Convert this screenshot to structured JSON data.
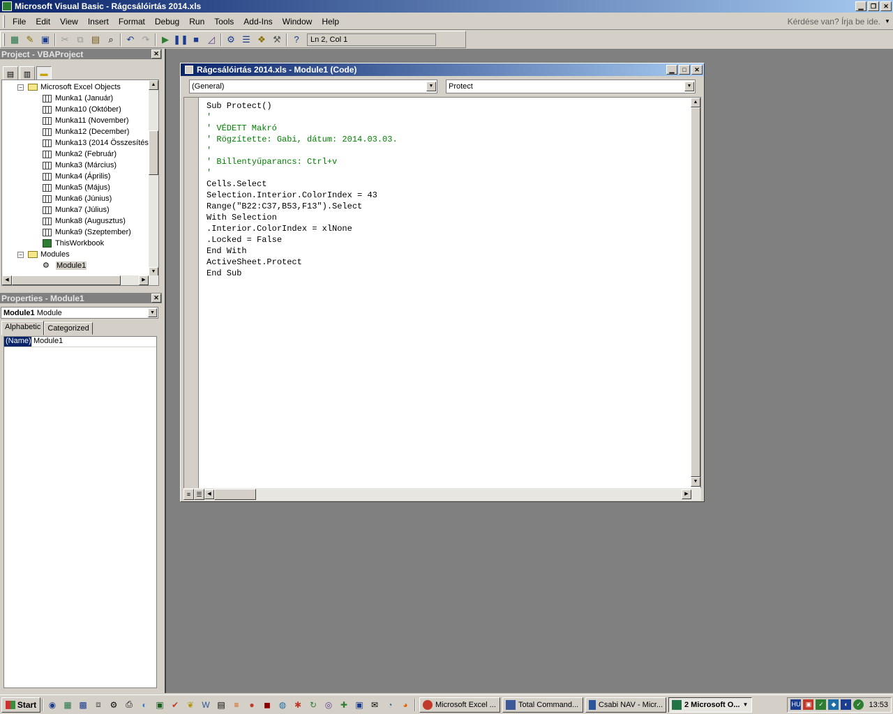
{
  "window": {
    "title": "Microsoft Visual Basic - Rágcsálóirtás 2014.xls",
    "minimize_glyph": "▁",
    "restore_glyph": "❐",
    "close_glyph": "✕"
  },
  "menu": {
    "items": [
      "File",
      "Edit",
      "View",
      "Insert",
      "Format",
      "Debug",
      "Run",
      "Tools",
      "Add-Ins",
      "Window",
      "Help"
    ],
    "help_box": "Kérdése van? Írja be ide."
  },
  "toolbar": {
    "position": "Ln 2, Col 1",
    "icons": [
      "excel-icon",
      "insert-module-icon",
      "save-icon",
      "cut-icon",
      "copy-icon",
      "paste-icon",
      "find-icon",
      "undo-icon",
      "redo-icon",
      "run-icon",
      "break-icon",
      "reset-icon",
      "design-mode-icon",
      "project-explorer-icon",
      "properties-icon",
      "object-browser-icon",
      "toolbox-icon",
      "help-icon"
    ]
  },
  "project_pane": {
    "title": "Project - VBAProject",
    "folder_excel_objects": "Microsoft Excel Objects",
    "sheets": [
      "Munka1 (Január)",
      "Munka10 (Október)",
      "Munka11 (November)",
      "Munka12 (December)",
      "Munka13 (2014 Összesítés)",
      "Munka2 (Február)",
      "Munka3 (Március)",
      "Munka4 (Április)",
      "Munka5 (Május)",
      "Munka6 (Június)",
      "Munka7 (Július)",
      "Munka8 (Augusztus)",
      "Munka9 (Szeptember)"
    ],
    "workbook": "ThisWorkbook",
    "folder_modules": "Modules",
    "module": "Module1"
  },
  "properties_pane": {
    "title": "Properties - Module1",
    "object_name": "Module1",
    "object_type": "Module",
    "tab_alphabetic": "Alphabetic",
    "tab_categorized": "Categorized",
    "prop_name": "(Name)",
    "prop_value": "Module1"
  },
  "code_window": {
    "title": "Rágcsálóirtás 2014.xls - Module1 (Code)",
    "object_combo": "(General)",
    "proc_combo": "Protect",
    "lines": [
      {
        "text": "Sub Protect()",
        "kind": "code"
      },
      {
        "text": "'",
        "kind": "comment"
      },
      {
        "text": "' VÉDETT Makró",
        "kind": "comment"
      },
      {
        "text": "' Rögzítette: Gabi, dátum: 2014.03.03.",
        "kind": "comment"
      },
      {
        "text": "'",
        "kind": "comment"
      },
      {
        "text": "' Billentyűparancs: Ctrl+v",
        "kind": "comment"
      },
      {
        "text": "'",
        "kind": "comment"
      },
      {
        "text": "Cells.Select",
        "kind": "code"
      },
      {
        "text": "Selection.Interior.ColorIndex = 43",
        "kind": "code"
      },
      {
        "text": "Range(\"B22:C37,B53,F13\").Select",
        "kind": "code"
      },
      {
        "text": "With Selection",
        "kind": "code"
      },
      {
        "text": ".Interior.ColorIndex = xlNone",
        "kind": "code"
      },
      {
        "text": ".Locked = False",
        "kind": "code"
      },
      {
        "text": "End With",
        "kind": "code"
      },
      {
        "text": "ActiveSheet.Protect",
        "kind": "code"
      },
      {
        "text": "End Sub",
        "kind": "code"
      }
    ]
  },
  "taskbar": {
    "start": "Start",
    "tasks": [
      {
        "label": "Microsoft Excel ...",
        "active": false,
        "color": "#c0392b"
      },
      {
        "label": "Total Command...",
        "active": false,
        "color": "#3b5998"
      },
      {
        "label": "Csabi NAV - Micr...",
        "active": false,
        "color": "#2b579a"
      },
      {
        "label": "2 Microsoft O...",
        "active": true,
        "color": "#217346"
      }
    ],
    "tray_language": "HU",
    "clock": "13:53"
  },
  "colors": {
    "title_active": "#0a246a",
    "comment": "#008000",
    "workspace": "#808080"
  }
}
